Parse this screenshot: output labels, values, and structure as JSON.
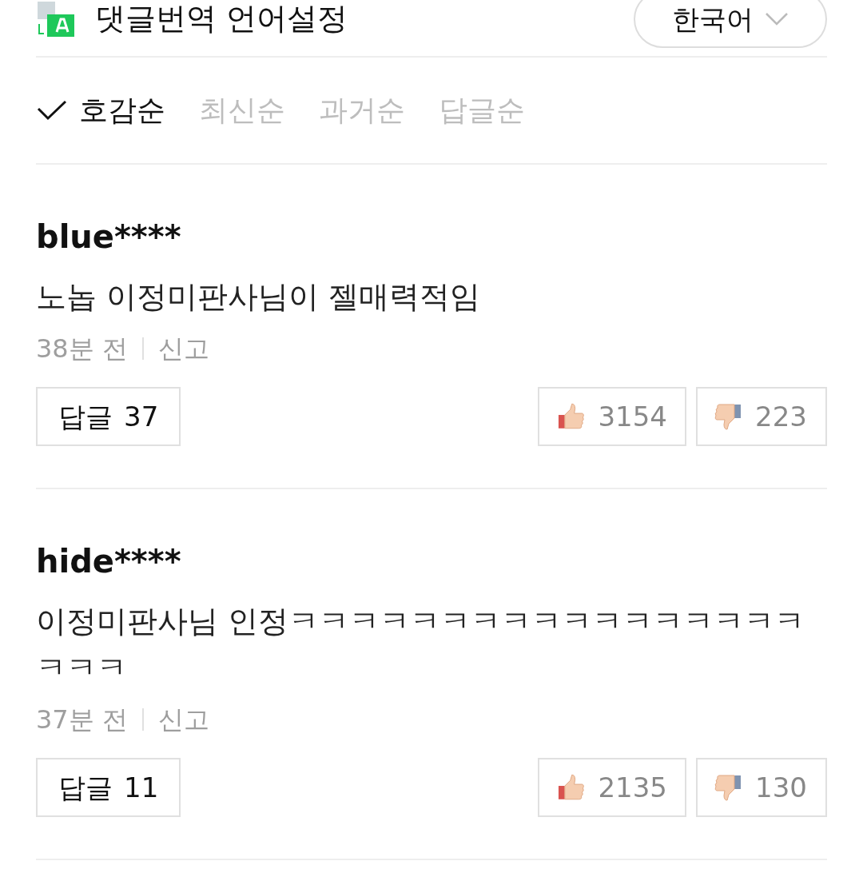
{
  "translate_setting": {
    "label": "댓글번역 언어설정",
    "language": "한국어"
  },
  "sort_options": [
    {
      "label": "호감순",
      "selected": true
    },
    {
      "label": "최신순",
      "selected": false
    },
    {
      "label": "과거순",
      "selected": false
    },
    {
      "label": "답글순",
      "selected": false
    }
  ],
  "comments": [
    {
      "user": "blue****",
      "text": "노놉 이정미판사님이 젤매력적임",
      "time": "38분 전",
      "report": "신고",
      "reply_label": "답글",
      "reply_count": "37",
      "likes": "3154",
      "dislikes": "223"
    },
    {
      "user": "hide****",
      "text": "이정미판사님 인정ㅋㅋㅋㅋㅋㅋㅋㅋㅋㅋㅋㅋㅋㅋㅋㅋㅋㅋㅋㅋ",
      "time": "37분 전",
      "report": "신고",
      "reply_label": "답글",
      "reply_count": "11",
      "likes": "2135",
      "dislikes": "130"
    }
  ]
}
